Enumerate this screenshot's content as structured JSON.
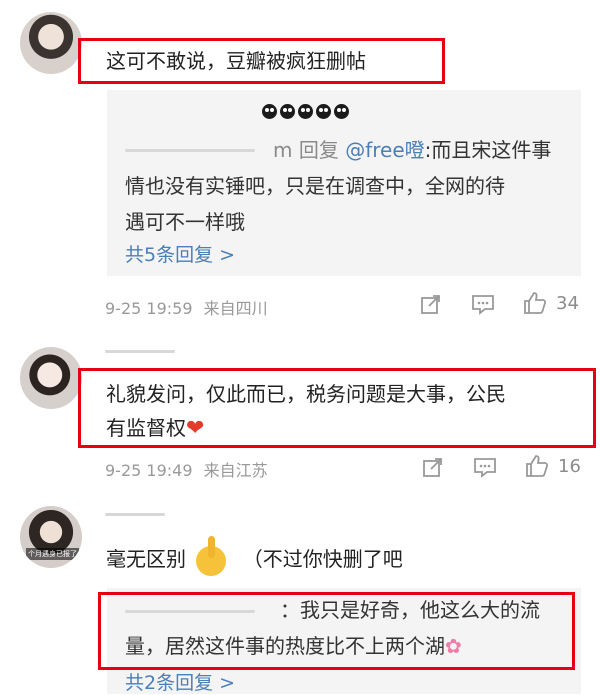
{
  "comments": [
    {
      "text": "这可不敢说，豆瓣被疯狂删帖",
      "reply": {
        "emoji_row": "◖●●●●",
        "prefix": "m 回复 ",
        "mention": "@free噔",
        "body": ":而且宋这件事情也没有实锤吧，只是在调查中，全网的待遇可不一样哦",
        "line1_rest": ":而且宋这件事",
        "line2": "情也没有实锤吧，只是在调查中，全网的待",
        "line3": "遇可不一样哦",
        "more": "共5条回复 >"
      },
      "date": "9-25 19:59",
      "location": "来自四川",
      "likes": "34"
    },
    {
      "text_line1": "礼貌发问，仅此而已，税务问题是大事，公民",
      "text_line2": "有监督权",
      "date": "9-25 19:49",
      "location": "来自江苏",
      "likes": "16"
    },
    {
      "text_main": "毫无区别",
      "text_tail": "（不过你快删了吧",
      "avatar_caption": "个月遇身已报了",
      "reply": {
        "line1": "：我只是好奇，他这么大的流",
        "line2": "量，居然这件事的热度比不上两个湖",
        "more": "共2条回复 >"
      }
    }
  ],
  "icons": [
    "share-icon",
    "comment-icon",
    "like-icon",
    "heart-emoji",
    "shush-emoji",
    "flower-emoji"
  ],
  "colors": {
    "highlight_box": "#e60012",
    "link": "#4a7fb8",
    "meta": "#999999",
    "reply_bg": "#f4f4f4"
  }
}
